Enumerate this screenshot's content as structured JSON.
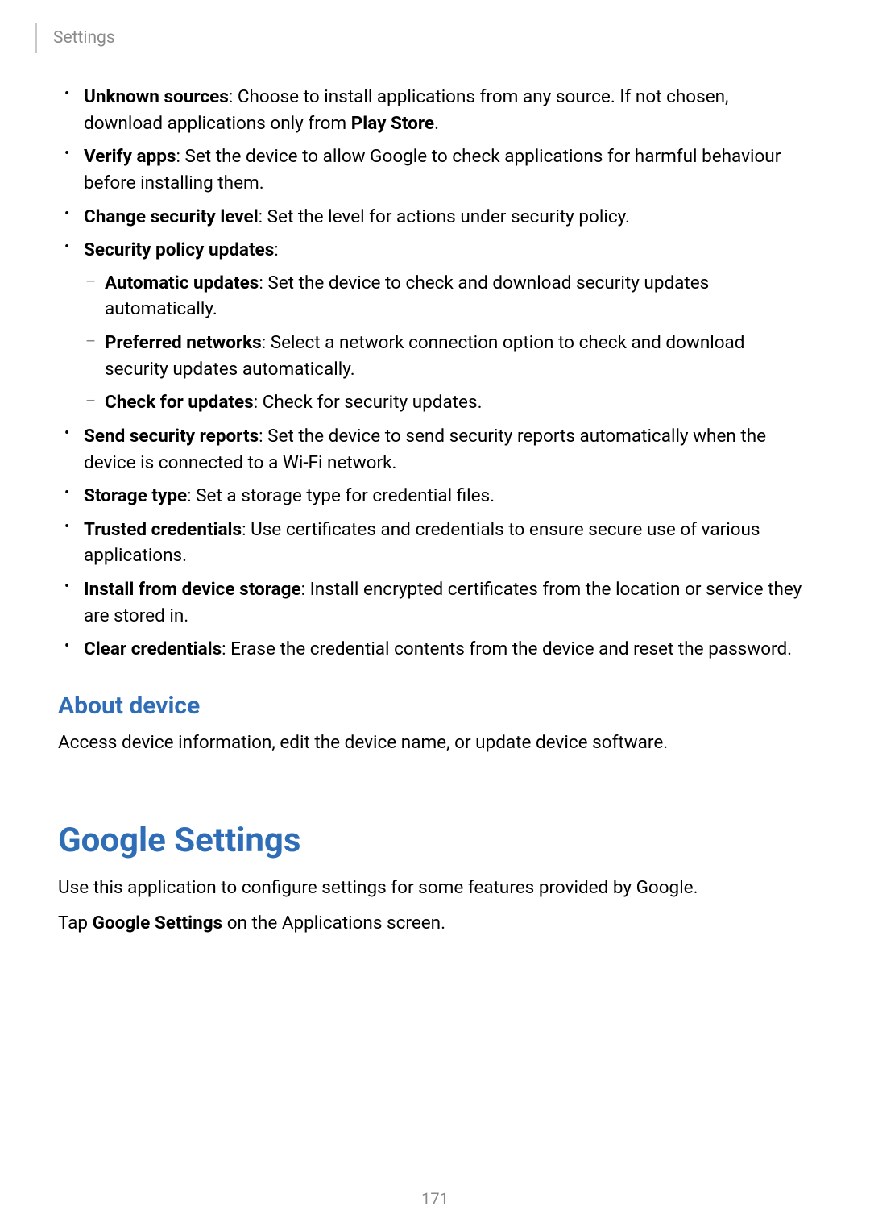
{
  "header": {
    "section_label": "Settings"
  },
  "security": {
    "items": [
      {
        "title": "Unknown sources",
        "desc_pre": ": Choose to install applications from any source. If not chosen, download applications only from ",
        "desc_bold": "Play Store",
        "desc_post": "."
      },
      {
        "title": "Verify apps",
        "desc": ": Set the device to allow Google to check applications for harmful behaviour before installing them."
      },
      {
        "title": "Change security level",
        "desc": ": Set the level for actions under security policy."
      },
      {
        "title": "Security policy updates",
        "desc": ":",
        "subitems": [
          {
            "title": "Automatic updates",
            "desc": ": Set the device to check and download security updates automatically."
          },
          {
            "title": "Preferred networks",
            "desc": ": Select a network connection option to check and download security updates automatically."
          },
          {
            "title": "Check for updates",
            "desc": ": Check for security updates."
          }
        ]
      },
      {
        "title": "Send security reports",
        "desc": ": Set the device to send security reports automatically when the device is connected to a Wi-Fi network."
      },
      {
        "title": "Storage type",
        "desc": ": Set a storage type for credential files."
      },
      {
        "title": "Trusted credentials",
        "desc": ": Use certificates and credentials to ensure secure use of various applications."
      },
      {
        "title": "Install from device storage",
        "desc": ": Install encrypted certificates from the location or service they are stored in."
      },
      {
        "title": "Clear credentials",
        "desc": ": Erase the credential contents from the device and reset the password."
      }
    ]
  },
  "about_device": {
    "heading": "About device",
    "body": "Access device information, edit the device name, or update device software."
  },
  "google_settings": {
    "heading": "Google Settings",
    "body1": "Use this application to configure settings for some features provided by Google.",
    "body2_pre": "Tap ",
    "body2_bold": "Google Settings",
    "body2_post": " on the Applications screen."
  },
  "page_number": "171"
}
